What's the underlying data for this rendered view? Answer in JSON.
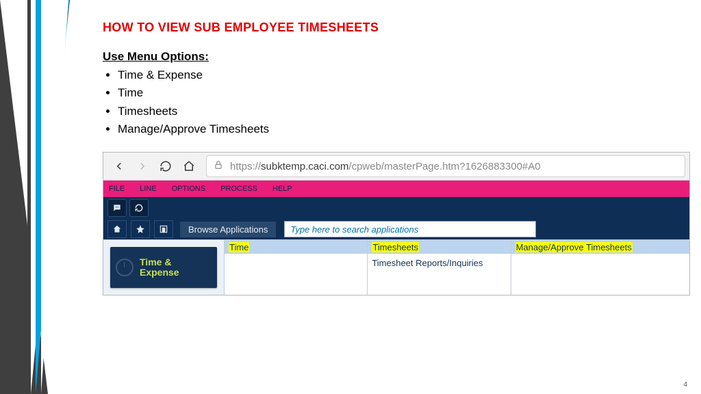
{
  "title": "HOW TO VIEW SUB EMPLOYEE TIMESHEETS",
  "subhead": "Use Menu Options:",
  "steps": [
    "Time & Expense",
    "Time",
    "Timesheets",
    "Manage/Approve Timesheets"
  ],
  "url": {
    "prefix": "https://",
    "host": "subktemp.caci.com",
    "path": "/cpweb/masterPage.htm?1626883300#A0"
  },
  "pinkMenu": [
    "FILE",
    "LINE",
    "OPTIONS",
    "PROCESS",
    "HELP"
  ],
  "browseLabel": "Browse Applications",
  "searchPlaceholder": "Type here to search applications",
  "tile": "Time &\nExpense",
  "cols": {
    "c1": "Time",
    "c2_head": "Timesheets",
    "c2_body": "Timesheet Reports/Inquiries",
    "c3": "Manage/Approve Timesheets"
  },
  "pageNum": "4"
}
